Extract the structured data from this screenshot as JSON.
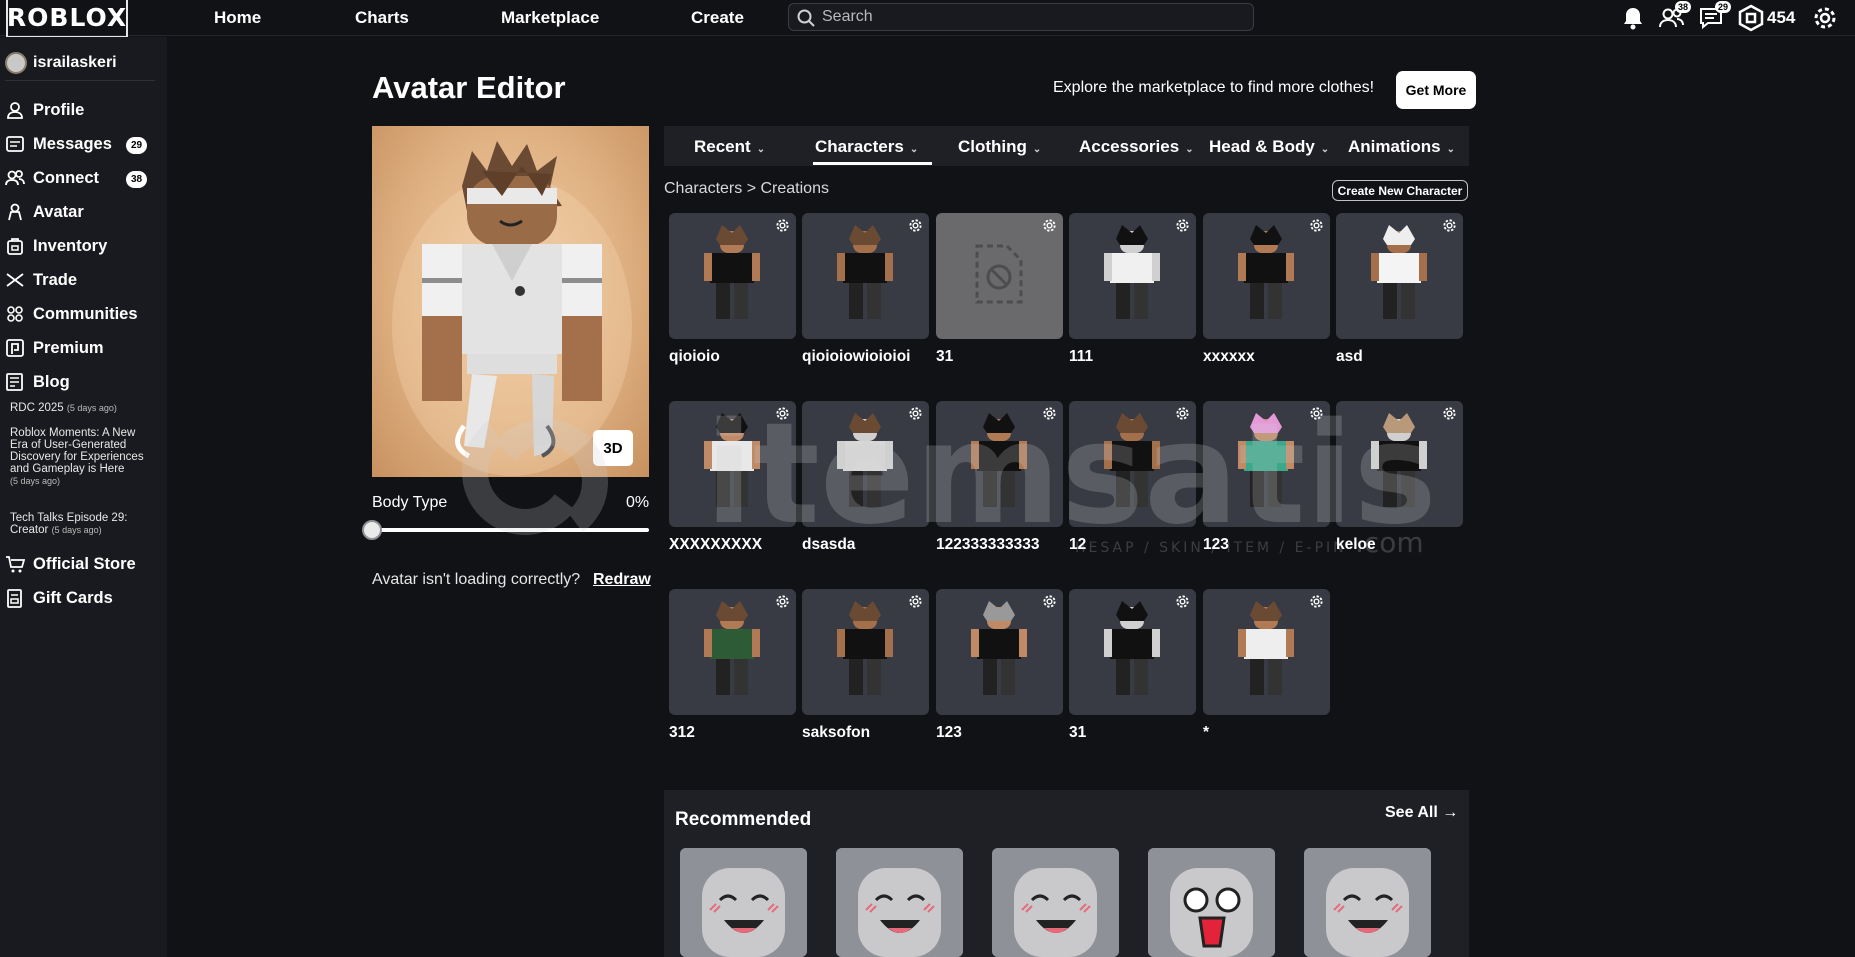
{
  "topbar": {
    "logo": "ROBLOX",
    "nav": [
      "Home",
      "Charts",
      "Marketplace",
      "Create"
    ],
    "search_placeholder": "Search",
    "friends_badge": "38",
    "messages_badge": "29",
    "robux": "454"
  },
  "sidebar": {
    "username": "israilaskeri",
    "items": [
      {
        "label": "Profile",
        "icon": "profile-icon"
      },
      {
        "label": "Messages",
        "icon": "messages-icon",
        "badge": "29"
      },
      {
        "label": "Connect",
        "icon": "connect-icon",
        "badge": "38"
      },
      {
        "label": "Avatar",
        "icon": "avatar-icon"
      },
      {
        "label": "Inventory",
        "icon": "inventory-icon"
      },
      {
        "label": "Trade",
        "icon": "trade-icon"
      },
      {
        "label": "Communities",
        "icon": "communities-icon"
      },
      {
        "label": "Premium",
        "icon": "premium-icon"
      },
      {
        "label": "Blog",
        "icon": "blog-icon"
      }
    ],
    "blog_posts": [
      {
        "title": "RDC 2025",
        "age": "(5 days ago)"
      },
      {
        "title": "Roblox Moments: A New Era of User-Generated Discovery for Experiences and Gameplay is Here",
        "age": "(5 days ago)"
      },
      {
        "title": "Tech Talks Episode 29: Creator",
        "age": "(5 days ago)"
      }
    ],
    "store_items": [
      {
        "label": "Official Store",
        "icon": "cart-icon"
      },
      {
        "label": "Gift Cards",
        "icon": "gift-card-icon"
      }
    ]
  },
  "editor": {
    "title": "Avatar Editor",
    "promo_text": "Explore the marketplace to find more clothes!",
    "get_more": "Get More",
    "btn_3d": "3D",
    "body_type_label": "Body Type",
    "body_type_value": "0%",
    "body_type_level": 0,
    "loading_text": "Avatar isn't loading correctly?",
    "redraw": "Redraw"
  },
  "tabs": [
    {
      "label": "Recent",
      "active": false
    },
    {
      "label": "Characters",
      "active": true
    },
    {
      "label": "Clothing",
      "active": false
    },
    {
      "label": "Accessories",
      "active": false
    },
    {
      "label": "Head & Body",
      "active": false
    },
    {
      "label": "Animations",
      "active": false
    }
  ],
  "breadcrumb": {
    "parent": "Characters",
    "separator": ">",
    "current": "Creations"
  },
  "create_new_character": "Create New Character",
  "characters": [
    {
      "name": "qioioio"
    },
    {
      "name": "qioioiowioioioi"
    },
    {
      "name": "31",
      "blocked": true
    },
    {
      "name": "111"
    },
    {
      "name": "xxxxxx"
    },
    {
      "name": "asd"
    },
    {
      "name": "XXXXXXXXX"
    },
    {
      "name": "dsasda"
    },
    {
      "name": "122333333333"
    },
    {
      "name": "12"
    },
    {
      "name": "123"
    },
    {
      "name": "keloe"
    },
    {
      "name": "312"
    },
    {
      "name": "saksofon"
    },
    {
      "name": "123"
    },
    {
      "name": "31"
    },
    {
      "name": "*"
    }
  ],
  "recommended": {
    "title": "Recommended",
    "see_all": "See All"
  },
  "watermark": {
    "brand": "itemsatis",
    "tagline": "HESAP / SKIN / ITEM / E-PIN",
    "suffix": ".com"
  },
  "colors": {
    "background": "#111216",
    "sidebar": "#191a1f",
    "card": "#393b44",
    "tabbar": "#1f2026"
  }
}
